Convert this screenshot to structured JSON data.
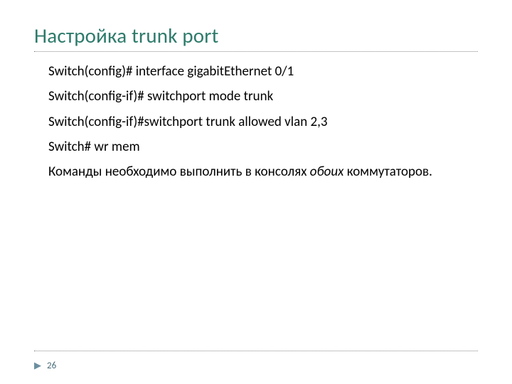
{
  "title": "Настройка trunk port",
  "commands": [
    "Switch(config)# interface gigabitEthernet 0/1",
    "Switch(config-if)# switchport mode trunk",
    "Switch(config-if)#switchport trunk allowed vlan 2,3",
    "Switch# wr mem"
  ],
  "note_prefix": "Команды необходимо выполнить в консолях ",
  "note_italic": "обоих",
  "note_suffix": " коммутаторов.",
  "page_number": "26",
  "bullet_glyph": "▶"
}
